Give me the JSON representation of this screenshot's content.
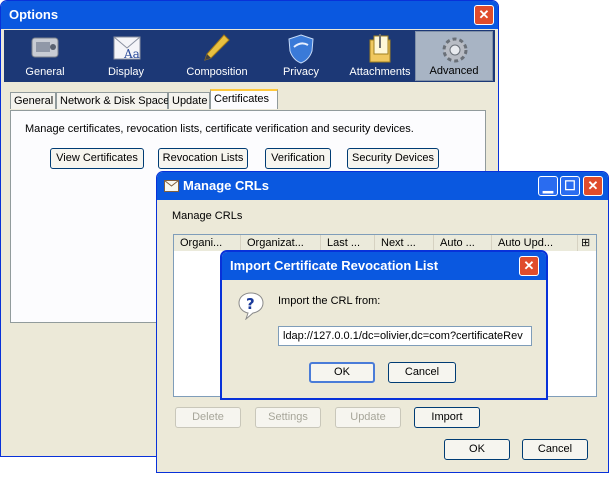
{
  "options": {
    "title": "Options",
    "toolbar": [
      {
        "label": "General",
        "icon": "general-icon"
      },
      {
        "label": "Display",
        "icon": "display-icon"
      },
      {
        "label": "Composition",
        "icon": "composition-icon"
      },
      {
        "label": "Privacy",
        "icon": "privacy-icon"
      },
      {
        "label": "Attachments",
        "icon": "attachments-icon"
      },
      {
        "label": "Advanced",
        "icon": "advanced-icon",
        "selected": true
      }
    ],
    "tabs": [
      "General",
      "Network & Disk Space",
      "Update",
      "Certificates"
    ],
    "description": "Manage certificates, revocation lists, certificate verification and security devices.",
    "buttons": {
      "view_certificates": "View Certificates",
      "revocation_lists": "Revocation Lists",
      "verification": "Verification",
      "security_devices": "Security Devices"
    }
  },
  "crls": {
    "title": "Manage CRLs",
    "heading": "Manage CRLs",
    "columns": [
      "Organi...",
      "Organizat...",
      "Last ...",
      "Next ...",
      "Auto ...",
      "Auto Upd..."
    ],
    "buttons": {
      "delete": "Delete",
      "settings": "Settings",
      "update": "Update",
      "import": "Import",
      "ok": "OK",
      "cancel": "Cancel"
    }
  },
  "import_dialog": {
    "title": "Import Certificate Revocation List",
    "prompt": "Import the CRL from:",
    "url_value": "ldap://127.0.0.1/dc=olivier,dc=com?certificateRev",
    "ok": "OK",
    "cancel": "Cancel"
  },
  "colors": {
    "title_bar": "#0a58e0",
    "toolbar_bg": "#1c3876",
    "dialog_bg": "#ece9d8",
    "close_button": "#e04c2c"
  }
}
